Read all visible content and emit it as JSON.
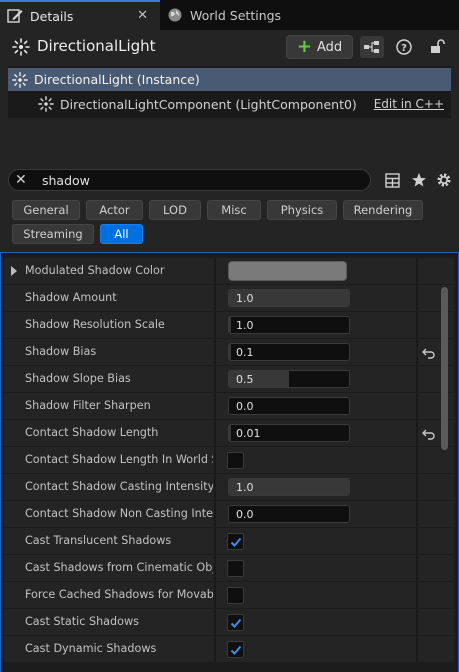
{
  "tabs": [
    {
      "label": "Details",
      "icon": "pencil-icon",
      "active": true
    },
    {
      "label": "World Settings",
      "icon": "globe-icon",
      "active": false
    }
  ],
  "header": {
    "actor_name": "DirectionalLight",
    "add_label": "Add"
  },
  "tree": {
    "instance_label": "DirectionalLight (Instance)",
    "component_label": "DirectionalLightComponent (LightComponent0)",
    "edit_label": "Edit in C++"
  },
  "search": {
    "query": "shadow"
  },
  "filters": [
    {
      "label": "General",
      "selected": false
    },
    {
      "label": "Actor",
      "selected": false
    },
    {
      "label": "LOD",
      "selected": false
    },
    {
      "label": "Misc",
      "selected": false
    },
    {
      "label": "Physics",
      "selected": false
    },
    {
      "label": "Rendering",
      "selected": false
    },
    {
      "label": "Streaming",
      "selected": false
    },
    {
      "label": "All",
      "selected": true
    }
  ],
  "properties": [
    {
      "name": "Modulated Shadow Color",
      "type": "color",
      "color": "#7a7a7a",
      "expandable": true
    },
    {
      "name": "Shadow Amount",
      "type": "number",
      "value": "1.0",
      "fill": 1.0
    },
    {
      "name": "Shadow Resolution Scale",
      "type": "number",
      "value": "1.0",
      "fill": 0.02
    },
    {
      "name": "Shadow Bias",
      "type": "number",
      "value": "0.1",
      "fill": 0.02,
      "reset": true
    },
    {
      "name": "Shadow Slope Bias",
      "type": "number",
      "value": "0.5",
      "fill": 0.5
    },
    {
      "name": "Shadow Filter Sharpen",
      "type": "number",
      "value": "0.0",
      "fill": 0.0
    },
    {
      "name": "Contact Shadow Length",
      "type": "number",
      "value": "0.01",
      "fill": 0.02,
      "reset": true
    },
    {
      "name": "Contact Shadow Length In World Space",
      "type": "check",
      "checked": false
    },
    {
      "name": "Contact Shadow Casting Intensity",
      "type": "number",
      "value": "1.0",
      "fill": 1.0
    },
    {
      "name": "Contact Shadow Non Casting Intensity",
      "type": "number",
      "value": "0.0",
      "fill": 0.0
    },
    {
      "name": "Cast Translucent Shadows",
      "type": "check",
      "checked": true
    },
    {
      "name": "Cast Shadows from Cinematic Objects Only",
      "type": "check",
      "checked": false
    },
    {
      "name": "Force Cached Shadows for Movable Primitives",
      "type": "check",
      "checked": false
    },
    {
      "name": "Cast Static Shadows",
      "type": "check",
      "checked": true
    },
    {
      "name": "Cast Dynamic Shadows",
      "type": "check",
      "checked": true
    }
  ],
  "colors": {
    "accent": "#0070e0",
    "selection": "#4a5a72",
    "add_plus": "#5fcf3c",
    "checkmark": "#3d8ee8"
  }
}
